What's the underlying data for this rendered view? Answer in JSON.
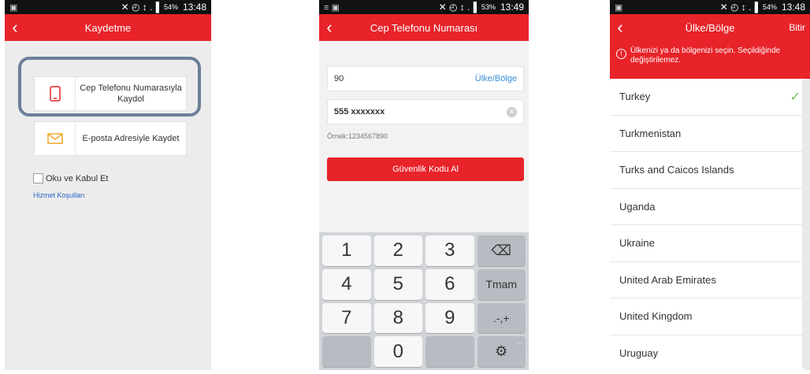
{
  "screen1": {
    "status": {
      "left": "▣",
      "icons": "✕ ◴ ↕ .▐",
      "battery": "54%",
      "time": "13:48"
    },
    "title": "Kaydetme",
    "phone_option": "Cep Telefonu Numarasıyla Kaydol",
    "email_option": "E-posta Adresiyle Kaydet",
    "agree_label": "Oku ve Kabul Et",
    "terms_link": "Hizmet Koşulları"
  },
  "screen2": {
    "status": {
      "left": "≡ ▣",
      "icons": "✕ ◴ ↕ .▐",
      "battery": "53%",
      "time": "13:49"
    },
    "title": "Cep Telefonu Numarası",
    "country_code": "90",
    "country_link": "Ülke/Bölge",
    "phone_value": "555 xxxxxxx",
    "example": "Örnek:1234567890",
    "get_code_button": "Güvenlik Kodu Al",
    "keys": [
      "1",
      "2",
      "3",
      "⌫",
      "4",
      "5",
      "6",
      "Tmam",
      "7",
      "8",
      "9",
      ".-,+",
      "",
      "0",
      "",
      "⚙"
    ],
    "key_extra": "..."
  },
  "screen3": {
    "status": {
      "left": "▣",
      "icons": "✕ ◴ ↕ .▐",
      "battery": "54%",
      "time": "13:48"
    },
    "title": "Ülke/Bölge",
    "done": "Bitir",
    "notice": "Ülkenizi ya da bölgenizi seçin. Seçildiğinde değiştirilemez.",
    "countries": [
      {
        "name": "Turkey",
        "selected": true
      },
      {
        "name": "Turkmenistan",
        "selected": false
      },
      {
        "name": "Turks and Caicos Islands",
        "selected": false
      },
      {
        "name": "Uganda",
        "selected": false
      },
      {
        "name": "Ukraine",
        "selected": false
      },
      {
        "name": "United Arab Emirates",
        "selected": false
      },
      {
        "name": "United Kingdom",
        "selected": false
      },
      {
        "name": "Uruguay",
        "selected": false
      }
    ]
  },
  "colors": {
    "accent": "#e8232a",
    "link": "#3a8fd8",
    "check": "#6dc05e",
    "highlight": "#6c7f98"
  }
}
